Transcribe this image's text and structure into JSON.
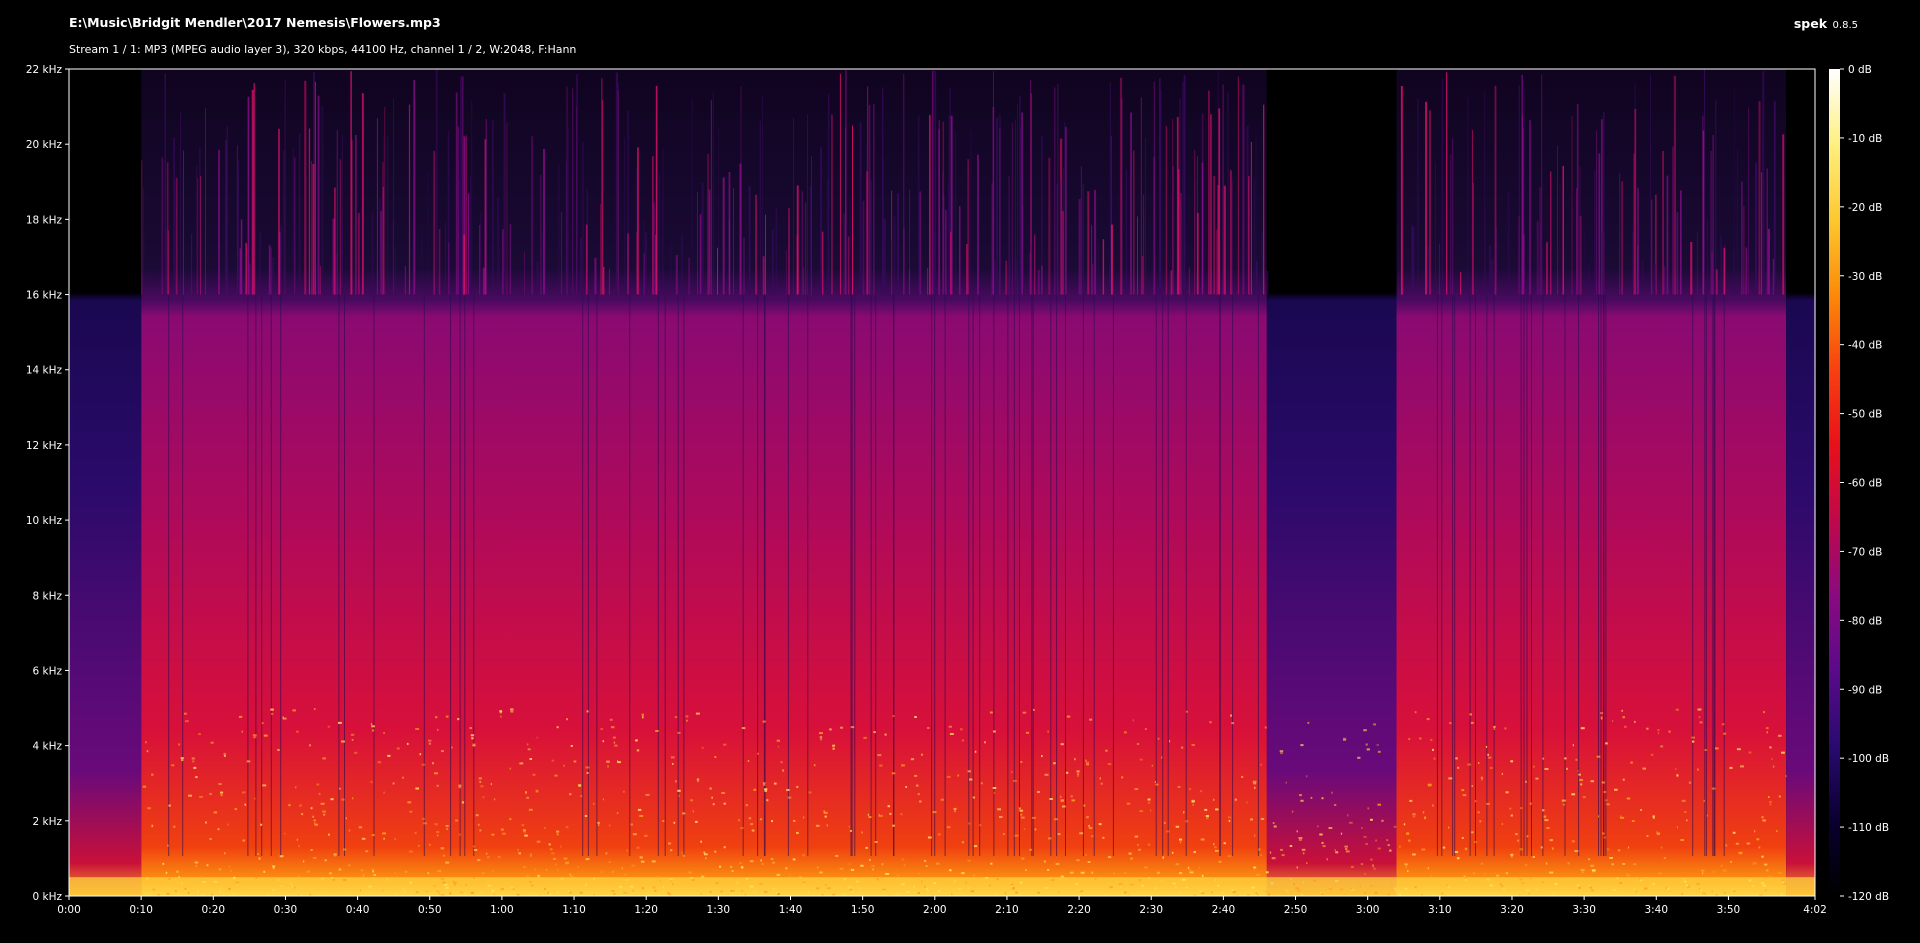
{
  "file": {
    "path": "E:\\Music\\Bridgit Mendler\\2017 Nemesis\\Flowers.mp3"
  },
  "stream": {
    "info": "Stream 1 / 1: MP3 (MPEG audio layer 3), 320 kbps, 44100 Hz, channel 1 / 2, W:2048, F:Hann"
  },
  "app": {
    "name": "spek",
    "version": "0.8.5"
  },
  "chart_data": {
    "type": "heatmap",
    "title": "",
    "x_axis": {
      "ticks": [
        "0:00",
        "0:10",
        "0:20",
        "0:30",
        "0:40",
        "0:50",
        "1:00",
        "1:10",
        "1:20",
        "1:30",
        "1:40",
        "1:50",
        "2:00",
        "2:10",
        "2:20",
        "2:30",
        "2:40",
        "2:50",
        "3:00",
        "3:10",
        "3:20",
        "3:30",
        "3:40",
        "3:50",
        "4:02"
      ],
      "duration_seconds": 242
    },
    "y_axis": {
      "ticks": [
        "0 kHz",
        "2 kHz",
        "4 kHz",
        "6 kHz",
        "8 kHz",
        "10 kHz",
        "12 kHz",
        "14 kHz",
        "16 kHz",
        "18 kHz",
        "20 kHz",
        "22 kHz"
      ],
      "range_khz": [
        0,
        22
      ]
    },
    "colorbar": {
      "ticks": [
        "0 dB",
        "-10 dB",
        "-20 dB",
        "-30 dB",
        "-40 dB",
        "-50 dB",
        "-60 dB",
        "-70 dB",
        "-80 dB",
        "-90 dB",
        "-100 dB",
        "-110 dB",
        "-120 dB"
      ],
      "range_db": [
        -120,
        0
      ],
      "colors": [
        "#000000",
        "#0a0030",
        "#2a0a70",
        "#5a0a8a",
        "#8a0a80",
        "#c0084a",
        "#e8101a",
        "#f84010",
        "#fc8a08",
        "#fdc830",
        "#fff080",
        "#ffffff"
      ]
    },
    "features": {
      "lowpass_cutoff_khz": 16,
      "silent_upper_band_seconds": [
        166,
        184
      ],
      "intro_end_seconds": 10,
      "outro_start_seconds": 238
    }
  }
}
